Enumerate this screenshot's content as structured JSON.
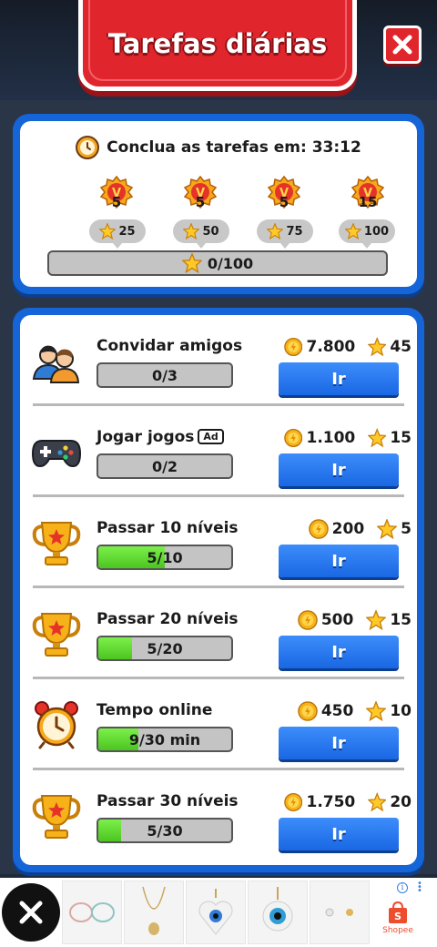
{
  "header": {
    "title": "Tarefas diárias"
  },
  "summary": {
    "timer_text": "Conclua as tarefas em: 33:12",
    "milestones": [
      {
        "medal": "5",
        "stars": "25"
      },
      {
        "medal": "5",
        "stars": "50"
      },
      {
        "medal": "5",
        "stars": "75"
      },
      {
        "medal": "15",
        "stars": "100"
      }
    ],
    "progress_text": "0/100",
    "progress_fraction": 0
  },
  "tasks": [
    {
      "title": "Convidar amigos",
      "ad": "",
      "progress_text": "0/3",
      "progress_fraction": 0,
      "coins": "7.800",
      "stars": "45",
      "button": "Ir",
      "icon": "friends-icon"
    },
    {
      "title": "Jogar jogos",
      "ad": "Ad",
      "progress_text": "0/2",
      "progress_fraction": 0,
      "coins": "1.100",
      "stars": "15",
      "button": "Ir",
      "icon": "gamepad-icon"
    },
    {
      "title": "Passar 10 níveis",
      "ad": "",
      "progress_text": "5/10",
      "progress_fraction": 0.5,
      "coins": "200",
      "stars": "5",
      "button": "Ir",
      "icon": "trophy-icon"
    },
    {
      "title": "Passar 20 níveis",
      "ad": "",
      "progress_text": "5/20",
      "progress_fraction": 0.25,
      "coins": "500",
      "stars": "15",
      "button": "Ir",
      "icon": "trophy-icon"
    },
    {
      "title": "Tempo online",
      "ad": "",
      "progress_text": "9/30 min",
      "progress_fraction": 0.3,
      "coins": "450",
      "stars": "10",
      "button": "Ir",
      "icon": "alarm-clock-icon"
    },
    {
      "title": "Passar 30 níveis",
      "ad": "",
      "progress_text": "5/30",
      "progress_fraction": 0.1667,
      "coins": "1.750",
      "stars": "20",
      "button": "Ir",
      "icon": "trophy-icon"
    }
  ],
  "ad_banner": {
    "brand": "Shopee"
  },
  "colors": {
    "accent_red": "#e0262c",
    "accent_blue": "#1565d8",
    "progress_green": "#4cc521"
  }
}
